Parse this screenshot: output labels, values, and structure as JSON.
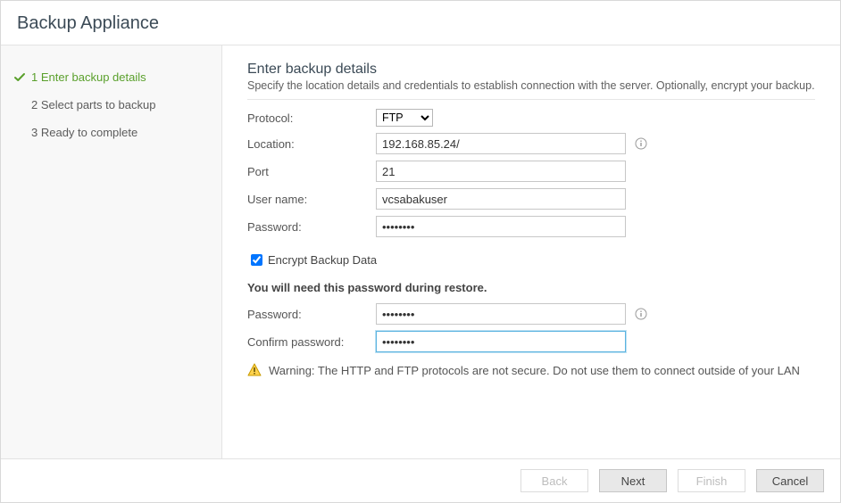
{
  "title": "Backup Appliance",
  "sidebar": {
    "steps": [
      {
        "label": "1 Enter backup details",
        "current": true
      },
      {
        "label": "2 Select parts to backup",
        "current": false
      },
      {
        "label": "3 Ready to complete",
        "current": false
      }
    ]
  },
  "content": {
    "heading": "Enter backup details",
    "subtitle": "Specify the location details and credentials to establish connection with the server. Optionally, encrypt your backup.",
    "protocol_label": "Protocol:",
    "protocol_value": "FTP",
    "location_label": "Location:",
    "location_value": "192.168.85.24/",
    "port_label": "Port",
    "port_value": "21",
    "username_label": "User name:",
    "username_value": "vcsabakuser",
    "password_label": "Password:",
    "password_value": "••••••••",
    "encrypt_label": "Encrypt Backup Data",
    "restore_note": "You will need this password during restore.",
    "enc_password_label": "Password:",
    "enc_password_value": "••••••••",
    "confirm_label": "Confirm password:",
    "confirm_value": "••••••••",
    "warning_text": "Warning: The HTTP and FTP protocols are not secure. Do not use them to connect outside of your LAN"
  },
  "footer": {
    "back": "Back",
    "next": "Next",
    "finish": "Finish",
    "cancel": "Cancel"
  }
}
